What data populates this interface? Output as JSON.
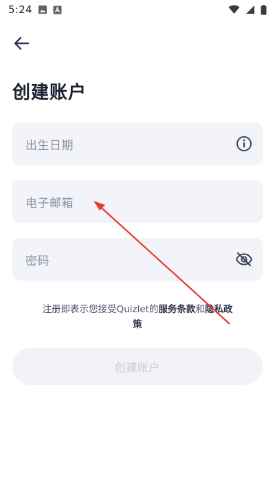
{
  "status_bar": {
    "time": "5:24",
    "icons": [
      "image-icon",
      "a-badge-icon",
      "wifi-icon",
      "signal-icon",
      "battery-icon"
    ]
  },
  "header": {
    "back_icon": "arrow-left-icon",
    "title": "创建账户"
  },
  "form": {
    "birthdate": {
      "placeholder": "出生日期",
      "icon": "info-icon"
    },
    "email": {
      "placeholder": "电子邮箱"
    },
    "password": {
      "placeholder": "密码",
      "icon": "eye-off-icon"
    }
  },
  "terms": {
    "prefix": "注册即表示您接受Quizlet的",
    "terms_link": "服务条款",
    "conjunction": "和",
    "privacy_link": "隐私政策"
  },
  "submit": {
    "label": "创建账户",
    "enabled": false
  },
  "colors": {
    "field_bg": "#f3f4f9",
    "placeholder": "#8a8fa6",
    "annotation_arrow": "#e53935"
  }
}
